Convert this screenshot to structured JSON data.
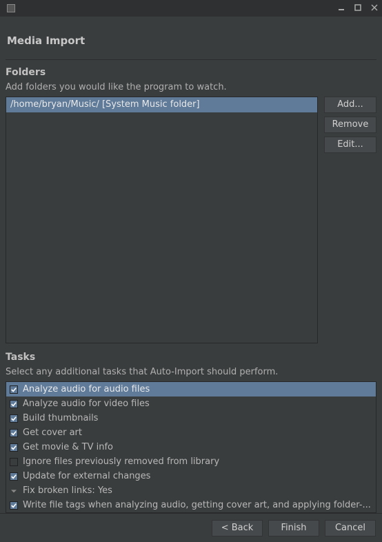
{
  "window": {
    "title": "Media Import"
  },
  "folders": {
    "title": "Folders",
    "desc": "Add folders you would like the program to watch.",
    "items": [
      {
        "path": "/home/bryan/Music/ [System Music folder]",
        "selected": true
      }
    ],
    "buttons": {
      "add": "Add...",
      "remove": "Remove",
      "edit": "Edit..."
    }
  },
  "tasks": {
    "title": "Tasks",
    "desc": "Select any additional tasks that Auto-Import should perform.",
    "items": [
      {
        "label": "Analyze audio for audio files",
        "checked": true,
        "selected": true,
        "type": "check"
      },
      {
        "label": "Analyze audio for video files",
        "checked": true,
        "type": "check"
      },
      {
        "label": "Build thumbnails",
        "checked": true,
        "type": "check"
      },
      {
        "label": "Get cover art",
        "checked": true,
        "type": "check"
      },
      {
        "label": "Get movie & TV info",
        "checked": true,
        "type": "check"
      },
      {
        "label": "Ignore files previously removed from library",
        "checked": false,
        "type": "check"
      },
      {
        "label": "Update for external changes",
        "checked": true,
        "type": "check"
      },
      {
        "label": "Fix broken links: Yes",
        "type": "dropdown"
      },
      {
        "label": "Write file tags when analyzing audio, getting cover art, and applying folder-...",
        "checked": true,
        "type": "check"
      }
    ]
  },
  "footer": {
    "back": "< Back",
    "finish": "Finish",
    "cancel": "Cancel"
  }
}
